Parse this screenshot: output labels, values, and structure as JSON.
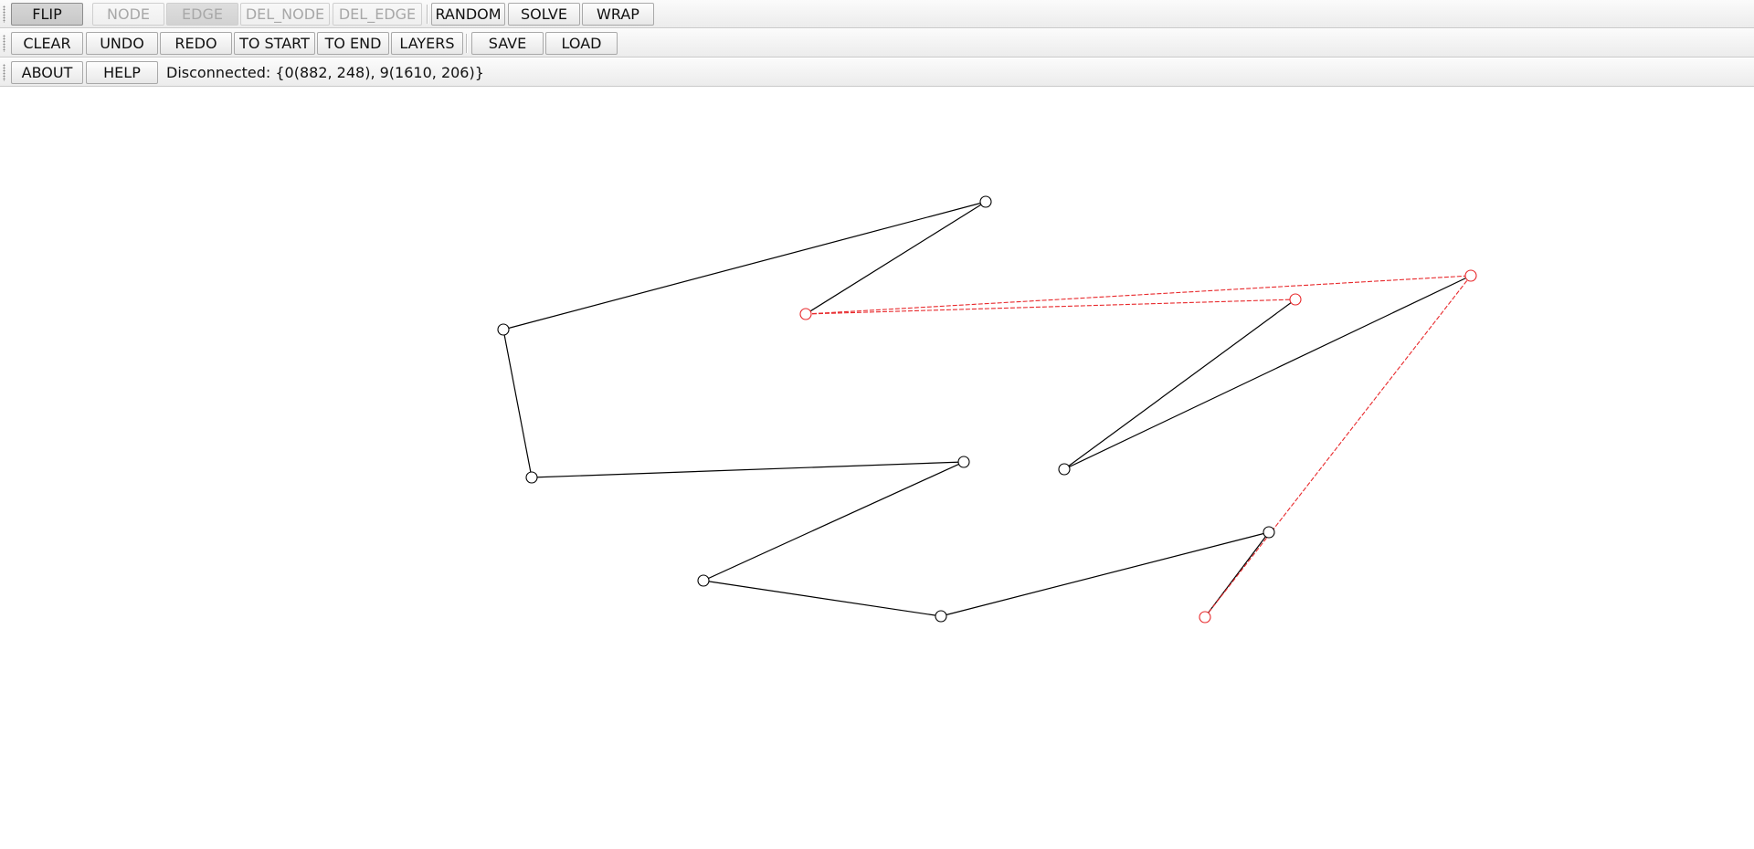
{
  "toolbar1": {
    "flip": "FLIP",
    "node": "NODE",
    "edge": "EDGE",
    "del_node": "DEL_NODE",
    "del_edge": "DEL_EDGE",
    "random": "RANDOM",
    "solve": "SOLVE",
    "wrap": "WRAP"
  },
  "toolbar2": {
    "clear": "CLEAR",
    "undo": "UNDO",
    "redo": "REDO",
    "to_start": "TO START",
    "to_end": "TO END",
    "layers": "LAYERS",
    "save": "SAVE",
    "load": "LOAD"
  },
  "toolbar3": {
    "about": "ABOUT",
    "help": "HELP",
    "status": "Disconnected: {0(882, 248), 9(1610, 206)}"
  },
  "colors": {
    "normal": "#000000",
    "highlight": "#e8282b"
  }
}
